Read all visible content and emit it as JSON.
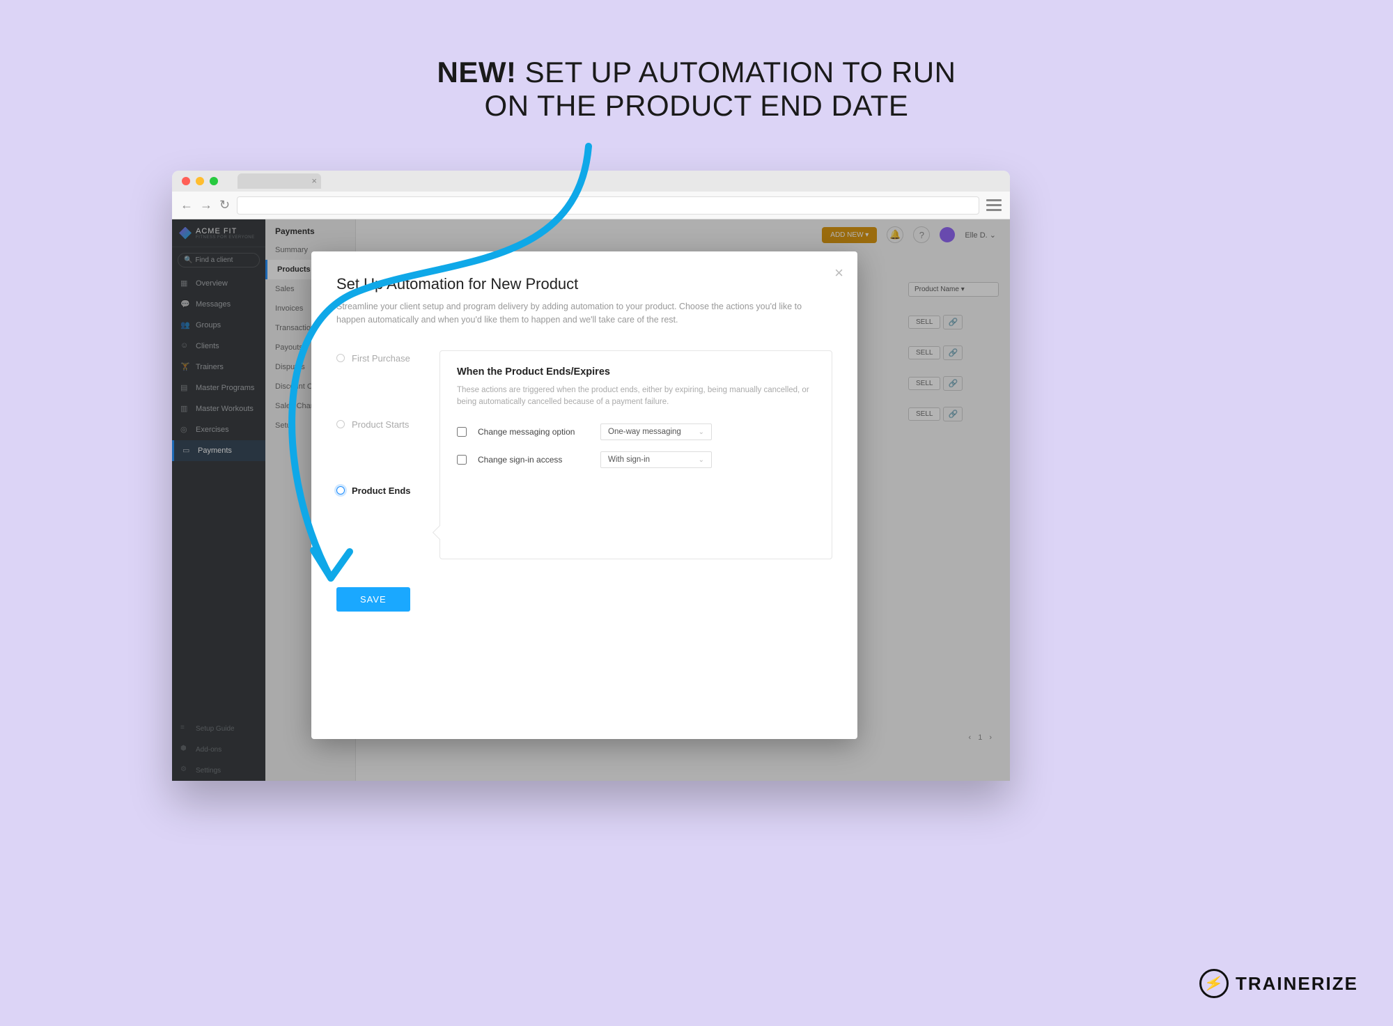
{
  "headline": {
    "strong": "NEW!",
    "rest1": " SET UP AUTOMATION TO RUN",
    "rest2": "ON THE PRODUCT END DATE"
  },
  "brand": {
    "name": "ACME FIT",
    "tagline": "FITNESS FOR EVERYONE"
  },
  "sidebar": {
    "search_placeholder": "Find a client",
    "items": [
      "Overview",
      "Messages",
      "Groups",
      "Clients",
      "Trainers",
      "Master Programs",
      "Master Workouts",
      "Exercises",
      "Payments"
    ],
    "bottom": [
      "Setup Guide",
      "Add-ons",
      "Settings"
    ]
  },
  "subnav": {
    "title": "Payments",
    "items": [
      "Summary",
      "Products",
      "Sales",
      "Invoices",
      "Transactions",
      "Payouts",
      "Disputes",
      "Discount Codes",
      "Sales Channels",
      "Setup"
    ],
    "active": "Products"
  },
  "topbar": {
    "add_new": "ADD NEW ▾",
    "user": "Elle D."
  },
  "product_filter_label": "Product Name",
  "sell_label": "SELL",
  "pagination": {
    "page": "1"
  },
  "modal": {
    "title": "Set Up Automation for New Product",
    "description": "Streamline your client setup and program delivery by adding automation to your product. Choose the actions you'd like to happen automatically and when you'd like them to happen and we'll take care of the rest.",
    "steps": [
      "First Purchase",
      "Product Starts",
      "Product Ends"
    ],
    "active_step": "Product Ends",
    "panel": {
      "heading": "When the Product Ends/Expires",
      "description": "These actions are triggered when the product ends, either by expiring, being manually cancelled, or being automatically cancelled because of a payment failure.",
      "option1_label": "Change messaging option",
      "option1_value": "One-way messaging",
      "option2_label": "Change sign-in access",
      "option2_value": "With sign-in"
    },
    "save": "SAVE"
  },
  "badge": "TRAINERIZE"
}
